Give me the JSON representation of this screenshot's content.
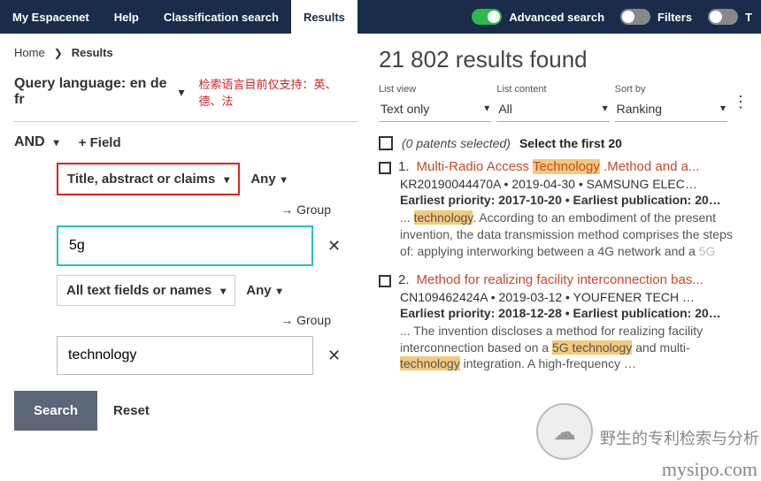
{
  "topbar": {
    "tabs": [
      "My Espacenet",
      "Help",
      "Classification search",
      "Results"
    ],
    "active_index": 3,
    "switches": [
      {
        "label": "Advanced search",
        "on": true
      },
      {
        "label": "Filters",
        "on": false
      },
      {
        "label": "T",
        "on": false
      }
    ]
  },
  "breadcrumb": {
    "home": "Home",
    "sep": "❯",
    "current": "Results"
  },
  "query_lang": {
    "label": "Query language: en de fr",
    "note": "检索语言目前仅支持：英、德、法"
  },
  "and_row": {
    "op": "AND",
    "plus_field": "+ Field"
  },
  "field_block_1": {
    "field_label": "Title, abstract or claims",
    "any": "Any",
    "group": "→ Group",
    "input_value": "5g"
  },
  "field_block_2": {
    "field_label": "All text fields or names",
    "any": "Any",
    "group": "→ Group",
    "input_value": "technology"
  },
  "buttons": {
    "search": "Search",
    "reset": "Reset"
  },
  "results": {
    "count_text": "21 802 results found",
    "columns": {
      "list_view": {
        "label": "List view",
        "value": "Text only"
      },
      "list_content": {
        "label": "List content",
        "value": "All"
      },
      "sort_by": {
        "label": "Sort by",
        "value": "Ranking"
      }
    },
    "selected_text": "(0 patents selected)",
    "select_first": "Select the first 20",
    "items": [
      {
        "num": "1.",
        "title_pre": "Multi-Radio Access ",
        "title_hl": "Technology",
        "title_post": " .Method and a...",
        "meta": "KR20190044470A • 2019-04-30 • SAMSUNG ELEC…",
        "priority": "Earliest priority: 2017-10-20 • Earliest publication: 20…",
        "abs_pre": "... ",
        "abs_hl1": "technology",
        "abs_mid": ". According to an embodiment of the present invention, the data transmission method comprises the steps of: applying interworking between a 4G network and a ",
        "abs_grey": "5G"
      },
      {
        "num": "2.",
        "title_pre": "Method for realizing facility interconnection bas...",
        "title_hl": "",
        "title_post": "",
        "meta": "CN109462424A • 2019-03-12 • YOUFENER TECH …",
        "priority": "Earliest priority: 2018-12-28 • Earliest publication: 20…",
        "abs_pre": "... The invention discloses a method for realizing facility interconnection based on a ",
        "abs_hl1": "5G technology",
        "abs_mid": " and multi-",
        "abs_hl2": "technology",
        "abs_post": " integration. A high-frequency …"
      }
    ]
  },
  "watermark": {
    "logotext": "野生的专利检索与分析",
    "domain": "mysipo.com"
  }
}
